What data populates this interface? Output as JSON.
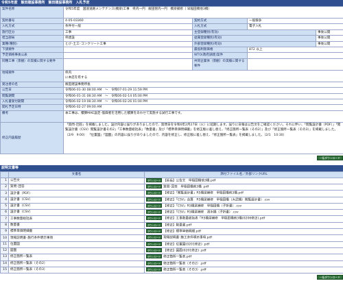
{
  "title": "令和5年度　飯田建設事務所　飯田建設事務所　入札予定",
  "labels": {
    "project_name": "案件名称",
    "contract_no": "契約番号",
    "contract_method": "契約方式",
    "bid_method": "入札方式",
    "bid_method2": "入札方式",
    "category": "施行区分",
    "main_reg": "主登録種別(有効)",
    "section": "担当部局",
    "sub_reg1": "従属登録種別(有効)",
    "work_type": "業種(種別)",
    "sub_reg2": "外部登録種別(有効)",
    "subcontract": "下請要件",
    "min_price": "最低制限価格",
    "upper_price": "予定価格事後公表",
    "wto": "WTO(政府調達)案件",
    "base_amount_open": "同種工事（景観）の実績に関する要件",
    "joint_open": "共同企業体（景観）の実績に関する要件",
    "region": "地域要件",
    "office": "発注者の名",
    "notice_date": "公告日",
    "view_period": "閲覧期間",
    "bid_period": "入札書受付期間",
    "open_date": "開札予定日時",
    "note": "備考",
    "revision": "修正内容履歴"
  },
  "values": {
    "project_name": "令和5年度　国道道路メンテナンス(橋梁)工事　県内一円　飯田管内一円　橋梁補修（\n早稲田橋他3橋）",
    "contract_no": "4-05-03360",
    "contract_method": "一般競争",
    "bid_method": "条件付一般",
    "bid_method2": "電子入札",
    "category": "工事",
    "main_reg": "事後公開",
    "section": "県建設",
    "sub_reg1": "事後公開",
    "work_type": "とび･土工･コンクリート工事",
    "sub_reg2": "事後公開",
    "subcontract": "",
    "min_price": "872 以上",
    "upper_price": "",
    "wto": "",
    "base_amount_open": "",
    "joint_open": "",
    "region_a": "県内",
    "region_b": "に本店を有する",
    "office": "飯田建設事務所長",
    "notice_date": "令和06-01-30 08:00 AM　～　令和07-01-29 11:59 PM",
    "view_period": "令和06-01-31 08:30 AM　～　令和06-02-14 05:00 PM",
    "bid_period": "令和06-02-19 08:30 AM　～　令和06-02-26 01:00 PM",
    "open_date": "令和06-02-27 09:00 AM",
    "note": "本工事は、積算MAE設定･復興者を活用した積算をあわせて実施する試行工事です。",
    "revision": "「質問･回答」を掲載しました。設計内容に誤りがありましたので、質問日を令和6年2月27日（火）に延期します。誤りに日報は公告文をご確認ください。それに伴い、「閲覧設計書（PDF）」「閲覧設計書（CSV）閲覧設計書その2」「工事数量総括表」「数量書」及び「標準単価明細書」を修正版に差し替え、「修正箇所一覧表（その2）」及び「修正箇所一覧表（その3）」を掲載しました。（2/9　9:00）\n「位置図」「図面」の内容に誤りがありましたので、内容を修正し、修正版に差し替え、「修正箇所一覧表」を掲載しました。（2/1　10:30）"
  },
  "download_all_label": "一括ダウンロード",
  "docs": {
    "section_title": "説明文書等",
    "col_name": "文書名",
    "col_file": "添付ファイル名／外部リンクURL",
    "icon_label": "ダウンロード",
    "rows": [
      {
        "no": "1",
        "name": "公告文",
        "file": "【延長】公告文　早稲田橋他3橋.pdf"
      },
      {
        "no": "2",
        "name": "質問･回答",
        "file": "質問･回答　早稲田橋他3橋 .pdf"
      },
      {
        "no": "3",
        "name": "設計書（PDF）",
        "file": "【修正】「閲覧設計書」R5橋梁補修　早稲田橋他3橋.pdf"
      },
      {
        "no": "4",
        "name": "設計書（CSV）",
        "file": "【修正】「CSV」合算　R5橋梁補修　早稲田橋（大武橋）閲覧設計書）.csv"
      },
      {
        "no": "5",
        "name": "設計書（CSV）",
        "file": "【修正】「CSV」R5橋梁補修　早稲田橋（子折書）.csv"
      },
      {
        "no": "6",
        "name": "設計書（CSV）",
        "file": "【修正】「CSV」R5橋梁補修　清水橋（子折書）.csv"
      },
      {
        "no": "7",
        "name": "工事数量総括表",
        "file": "【修正】工事数量総括表「R5橋梁補修　早稲田橋他3橋(0206修正).pdf"
      },
      {
        "no": "8",
        "name": "数量書",
        "file": "【修正】数量書.pdf"
      },
      {
        "no": "9",
        "name": "標準単価明細書",
        "file": "【修正】標準単価明細.pdf"
      },
      {
        "no": "10",
        "name": "現場説明書･施行条件明示事項",
        "file": "現場説明書･施工条件明示事項.pdf"
      },
      {
        "no": "11",
        "name": "位置図",
        "file": "【修正】位置図(0201修正) .pdf"
      },
      {
        "no": "12",
        "name": "図面",
        "file": "【修正】図面(0201修正) .pdf"
      },
      {
        "no": "13",
        "name": "修正箇所一覧表",
        "file": "修正箇所一覧表.pdf"
      },
      {
        "no": "14",
        "name": "修正箇所一覧表（その2）",
        "file": "修正箇所一覧表（その2）.pdf"
      },
      {
        "no": "15",
        "name": "修正箇所一覧表（その3）",
        "file": "修正箇所一覧表（その3）.pdf"
      }
    ]
  }
}
